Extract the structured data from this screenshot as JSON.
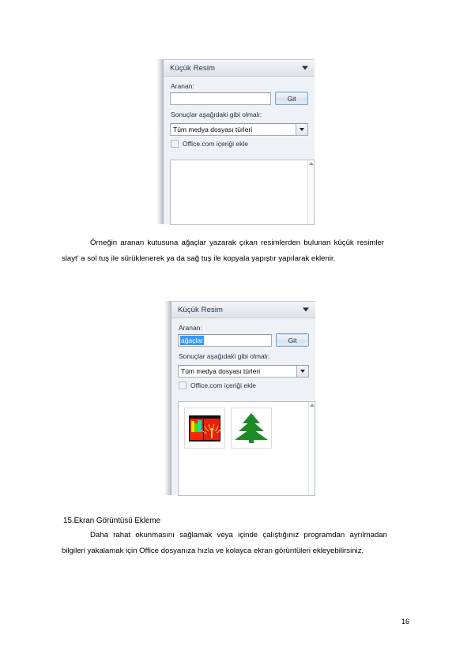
{
  "document": {
    "page_number": "16",
    "paragraph_1": "Örneğin aranan kutusuna ağaçlar yazarak çıkan resimlerden bulunan küçük resimler slayt' a sol tuş ile sürüklenerek ya da sağ tuş ile kopyala yapıştır yapılarak eklenir.",
    "heading_1": "15.Ekran Görüntüsü Ekleme",
    "paragraph_2": "Daha rahat okunmasını sağlamak veya içinde çalıştığınız programdan ayrılmadan bilgileri yakalamak için Office dosyanıza hızla ve kolayca ekran görüntüleri ekleyebilirsiniz."
  },
  "screenshot_1": {
    "pane_title": "Küçük Resim",
    "collapse_icon": "chevron-down-icon",
    "search_label": "Aranan:",
    "search_value": "",
    "search_placeholder": "",
    "go_button_label": "Git",
    "results_label": "Sonuçlar aşağıdaki gibi olmalı:",
    "media_type_value": "Tüm medya dosyası türleri",
    "media_type_arrow": "chevron-down-icon",
    "include_office_label": "Office.com içeriği ekle",
    "include_office_checked": false,
    "results": []
  },
  "screenshot_2": {
    "pane_title": "Küçük Resim",
    "collapse_icon": "chevron-down-icon",
    "search_label": "Aranan:",
    "search_value": "ağaçlar",
    "search_selected": true,
    "go_button_label": "Git",
    "results_label": "Sonuçlar aşağıdaki gibi olmalı:",
    "media_type_value": "Tüm medya dosyası türleri",
    "media_type_arrow": "chevron-down-icon",
    "include_office_label": "Office.com içeriği ekle",
    "include_office_checked": false,
    "results": [
      {
        "name": "abstract-colorful-trees-clipart"
      },
      {
        "name": "green-fir-tree-clipart"
      }
    ]
  },
  "colors": {
    "pane_background": "#eef1f5",
    "pane_title_text": "#20364f",
    "selection_blue": "#3399ff",
    "button_border_blue": "#7ea6d4",
    "tree_green": "#1e8a25",
    "art_red": "#e81f0c"
  }
}
